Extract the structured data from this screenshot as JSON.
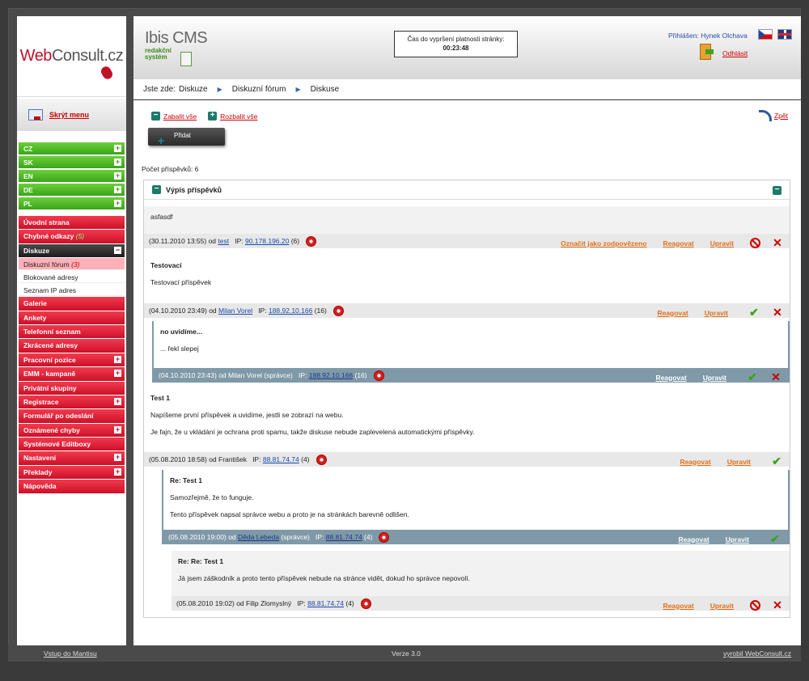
{
  "logo": {
    "text_web": "Web",
    "text_consult": "Consult.cz"
  },
  "sidebar": {
    "hide_menu": "Skrýt menu",
    "languages": [
      "CZ",
      "SK",
      "EN",
      "DE",
      "PL"
    ],
    "menu": [
      {
        "label": "Úvodní strana",
        "plus": false
      },
      {
        "label": "Chybné odkazy",
        "count": "(5)",
        "plus": false
      },
      {
        "label": "Diskuze",
        "active": true,
        "minus": true
      },
      {
        "sub": "Diskuzní fórum",
        "count": "(3)",
        "active": true
      },
      {
        "sub": "Blokované adresy"
      },
      {
        "sub": "Seznam IP adres"
      },
      {
        "label": "Galerie"
      },
      {
        "label": "Ankety"
      },
      {
        "label": "Telefonní seznam"
      },
      {
        "label": "Zkrácené adresy"
      },
      {
        "label": "Pracovní pozice",
        "plus": true
      },
      {
        "label": "EMM - kampaně",
        "plus": true
      },
      {
        "label": "Privátní skupiny"
      },
      {
        "label": "Registrace",
        "plus": true
      },
      {
        "label": "Formulář po odeslání"
      },
      {
        "label": "Oznámené chyby",
        "plus": true
      },
      {
        "label": "Systémové Editboxy"
      },
      {
        "label": "Nastavení",
        "plus": true
      },
      {
        "label": "Překlady",
        "plus": true
      },
      {
        "label": "Nápověda"
      }
    ]
  },
  "header": {
    "brand": "Ibis CMS",
    "brand_sub1": "redakční",
    "brand_sub2": "systém",
    "timer_label": "Čas do vypršení platnosti stránky:",
    "timer_value": "00:23:48",
    "logged_label": "Přihlášen:",
    "logged_user": "Hynek Olchava",
    "logout": "Odhlásit"
  },
  "breadcrumb": {
    "label": "Jste zde:",
    "items": [
      "Diskuze",
      "Diskuzní fórum",
      "Diskuse"
    ]
  },
  "toolbar": {
    "collapse_all": "Zabalit vše",
    "expand_all": "Rozbalit vše",
    "add": "Přidat",
    "back": "Zpět"
  },
  "count_label": "Počet příspěvků: 6",
  "box_title": "Výpis příspěvků",
  "actions": {
    "mark_answered": "Označit jako zodpovězeno",
    "reply": "Reagovat",
    "edit": "Upravit"
  },
  "posts": [
    {
      "title": "",
      "lines": [
        "asfasdf"
      ],
      "date": "(30.11.2010 13:55) od",
      "user": "test",
      "ip_label": "IP:",
      "ip": "90.178.196.20",
      "ipcount": "(6)"
    },
    {
      "title": "Testovací",
      "lines": [
        "Testovací příspěvek"
      ],
      "date": "(04.10.2010 23:49) od",
      "user": "Milan Vorel",
      "ip_label": "IP:",
      "ip": "188.92.10.166",
      "ipcount": "(16)"
    },
    {
      "title": "no uvidíme...",
      "lines": [
        "... řekl slepej"
      ],
      "date": "(04.10.2010 23:43) od Milan Vorel (správce)",
      "user": "",
      "ip_label": "IP:",
      "ip": "188.92.10.166",
      "ipcount": "(16)"
    },
    {
      "title": "Test 1",
      "lines": [
        "Napíšeme první příspěvek a uvidíme, jestli se zobrazí na webu.",
        "Je fajn, že u vkládání je ochrana proti spamu, takže diskuse nebude zaplevelená automatickými příspěvky."
      ],
      "date": "(05.08.2010 18:58) od František",
      "user": "",
      "ip_label": "IP:",
      "ip": "88.81.74.74",
      "ipcount": "(4)"
    },
    {
      "title": "Re: Test 1",
      "lines": [
        "Samozřejmě, že to funguje.",
        "Tento příspěvek napsal správce webu a proto je na stránkách barevně odlišen."
      ],
      "date": "(05.08.2010 19:00) od",
      "user": "Děda Lebeda",
      "suffix": "(správce)",
      "ip_label": "IP:",
      "ip": "88.81.74.74",
      "ipcount": "(4)"
    },
    {
      "title": "Re: Re: Test 1",
      "lines": [
        "Já jsem záškodník a proto tento příspěvek nebude na stránce vidět, dokud ho správce nepovolí."
      ],
      "date": "(05.08.2010 19:02) od Filip Zlomyslný",
      "user": "",
      "ip_label": "IP:",
      "ip": "88.81.74.74",
      "ipcount": "(4)"
    }
  ],
  "footer": {
    "left": "Vstup do Mantisu",
    "version": "Verze 3.0",
    "right": "vyrobil WebConsult.cz"
  }
}
